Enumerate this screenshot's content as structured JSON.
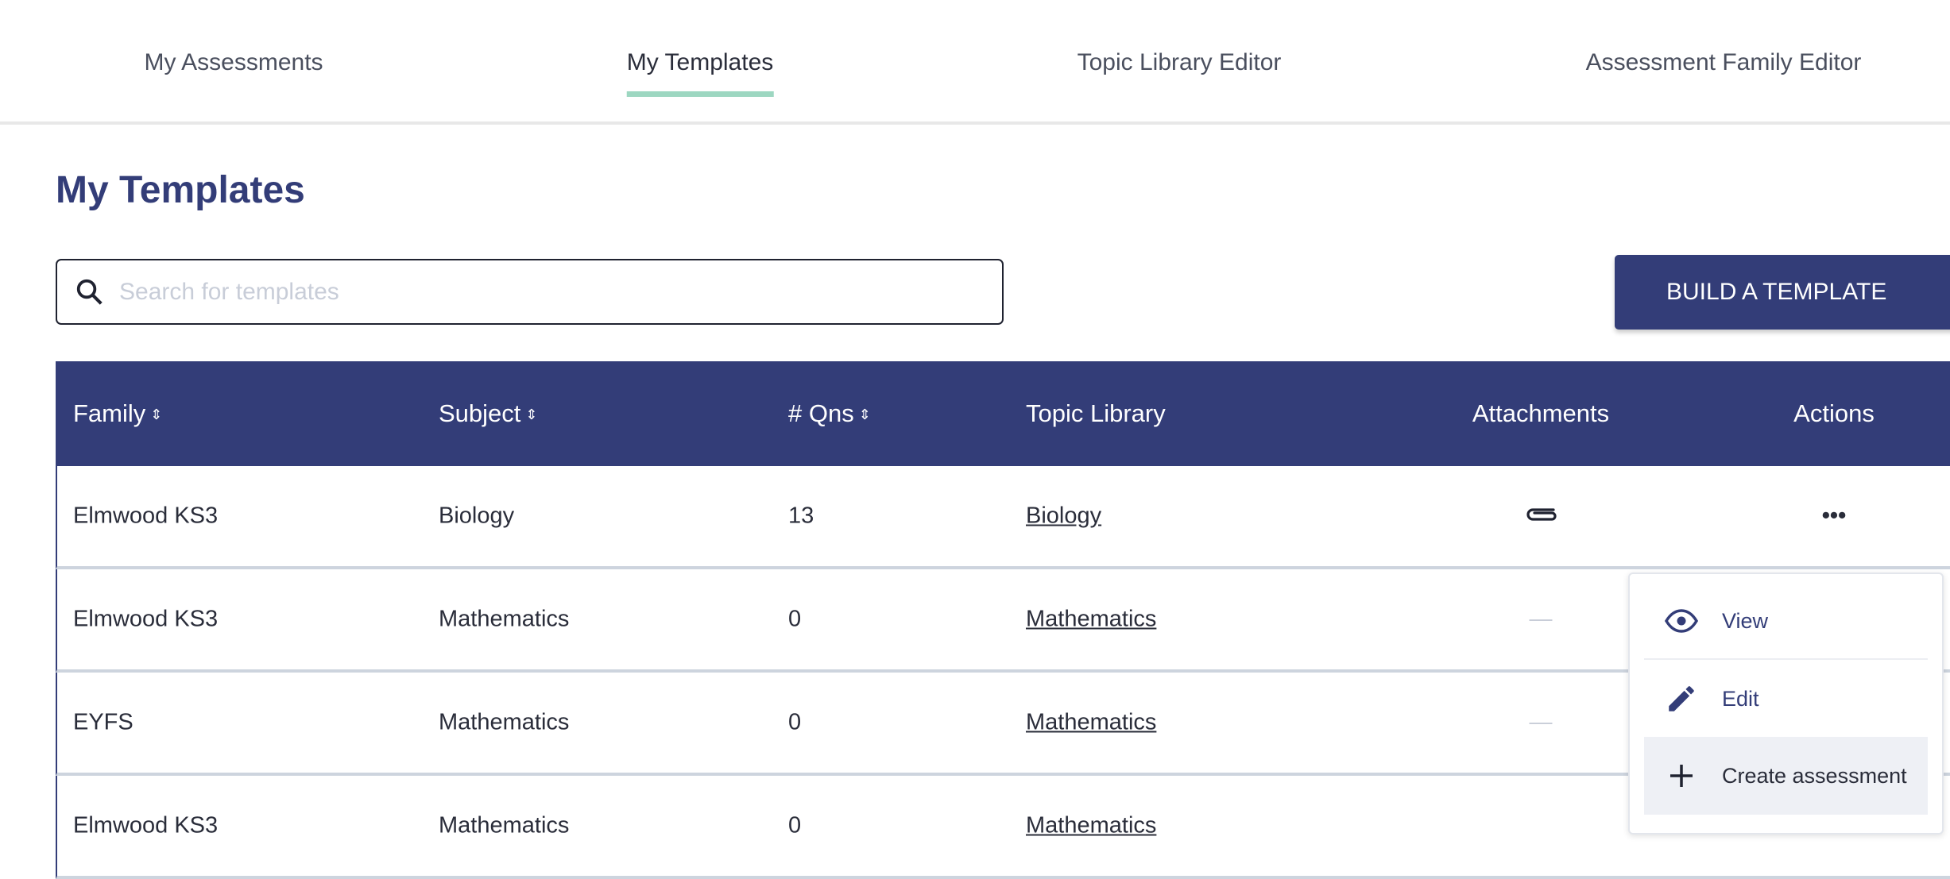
{
  "nav": {
    "tabs": [
      {
        "label": "My Assessments"
      },
      {
        "label": "My Templates",
        "active": true
      },
      {
        "label": "Topic Library Editor"
      },
      {
        "label": "Assessment Family Editor"
      }
    ]
  },
  "page": {
    "title": "My Templates"
  },
  "search": {
    "placeholder": "Search for templates",
    "value": ""
  },
  "toolbar": {
    "build_label": "BUILD A TEMPLATE"
  },
  "table": {
    "headers": [
      "Family",
      "Subject",
      "# Qns",
      "Topic Library",
      "Attachments",
      "Actions"
    ],
    "rows": [
      {
        "family": "Elmwood KS3",
        "subject": "Biology",
        "qns": "13",
        "topic": "Biology",
        "attachments": "paperclip-icon",
        "actions": "•••"
      },
      {
        "family": "Elmwood KS3",
        "subject": "Mathematics",
        "qns": "0",
        "topic": "Mathematics",
        "attachments": "—"
      },
      {
        "family": "EYFS",
        "subject": "Mathematics",
        "qns": "0",
        "topic": "Mathematics",
        "attachments": "—"
      },
      {
        "family": "Elmwood KS3",
        "subject": "Mathematics",
        "qns": "0",
        "topic": "Mathematics"
      }
    ]
  },
  "menu": {
    "items": [
      {
        "label": "View",
        "icon": "eye-icon"
      },
      {
        "label": "Edit",
        "icon": "pencil-icon"
      },
      {
        "label": "Create assessment",
        "icon": "plus-icon",
        "highlighted": true
      }
    ]
  },
  "colors": {
    "primary": "#333d78",
    "accent": "#9dd7c1",
    "highlight": "#eef0f5"
  }
}
